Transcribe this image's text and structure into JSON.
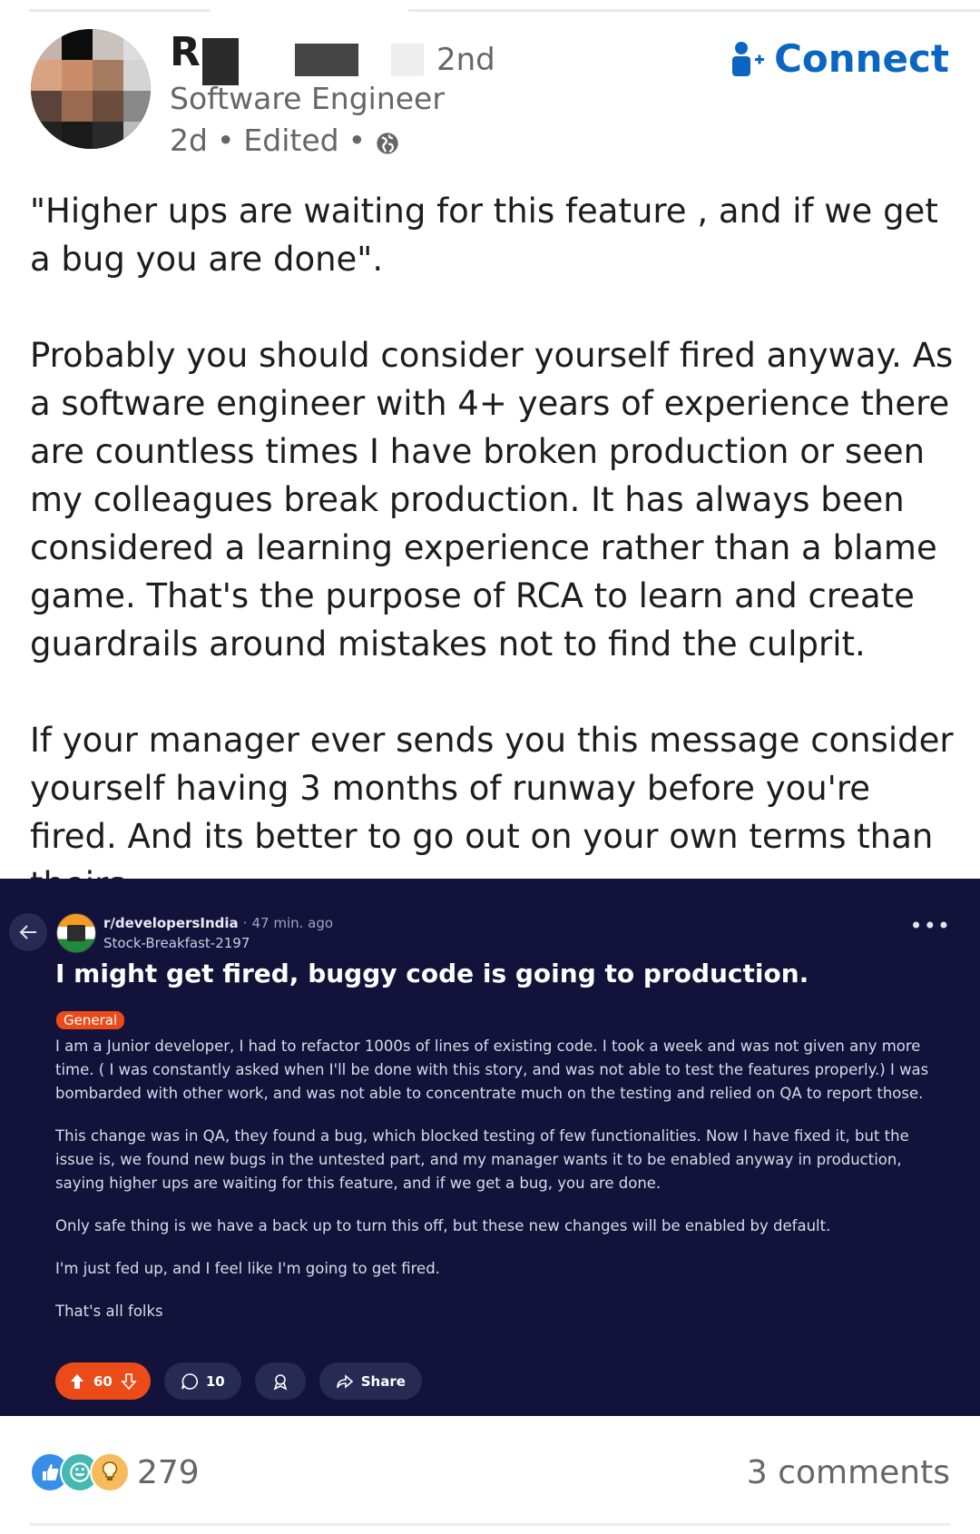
{
  "author": {
    "name": "R",
    "degree": "2nd",
    "headline": "Software Engineer",
    "time": "2d",
    "edited": "Edited",
    "separator": "•",
    "visibility_icon": "globe-icon"
  },
  "connect": {
    "label": "Connect",
    "icon": "add-person-icon",
    "color": "#0a66c2"
  },
  "post": {
    "paragraphs": [
      "\"Higher ups are waiting for this feature , and if we get a bug you are done\".",
      "Probably you should consider yourself fired anyway. As a software engineer with 4+ years of experience there are countless times I have broken production or seen my colleagues break production. It has always been considered a learning experience rather than a blame game. That's the purpose of RCA to learn and create guardrails around mistakes not to find the culprit.",
      "If your manager ever sends you this message consider yourself having 3 months of runway before you're fired. And its better to go out on your own terms than theirs."
    ]
  },
  "embed": {
    "subreddit": "r/developersIndia",
    "time_ago": "47 min. ago",
    "separator": "·",
    "username": "Stock-Breakfast-2197",
    "more": "•••",
    "title": "I might get fired, buggy code is going to production.",
    "flair": "General",
    "paragraphs": [
      "I am a Junior developer, I had to refactor 1000s of lines of existing code. I took a week and was not given any more time. ( I was constantly asked when I'll be done with this story, and was not able to test the features properly.) I was bombarded with other work, and was not able to concentrate much on the testing and relied on QA to report those.",
      "This change was in QA, they found a bug, which blocked testing of few functionalities. Now I have fixed it, but the issue is, we found new bugs in the untested part, and my manager wants it to be enabled anyway in production, saying higher ups are waiting for this feature, and if we get a bug, you are done.",
      "Only safe thing is we have a back up to turn this off, but these new changes will be enabled by default.",
      "I'm just fed up, and I feel like I'm going to get fired.",
      "That's all folks"
    ],
    "votes": "60",
    "comments": "10",
    "share": "Share",
    "background": "#12123a",
    "accent": "#ea4b18"
  },
  "footer": {
    "reaction_icons": [
      "like-icon",
      "funny-icon",
      "insightful-icon"
    ],
    "reaction_count": "279",
    "comments_label": "3 comments"
  }
}
